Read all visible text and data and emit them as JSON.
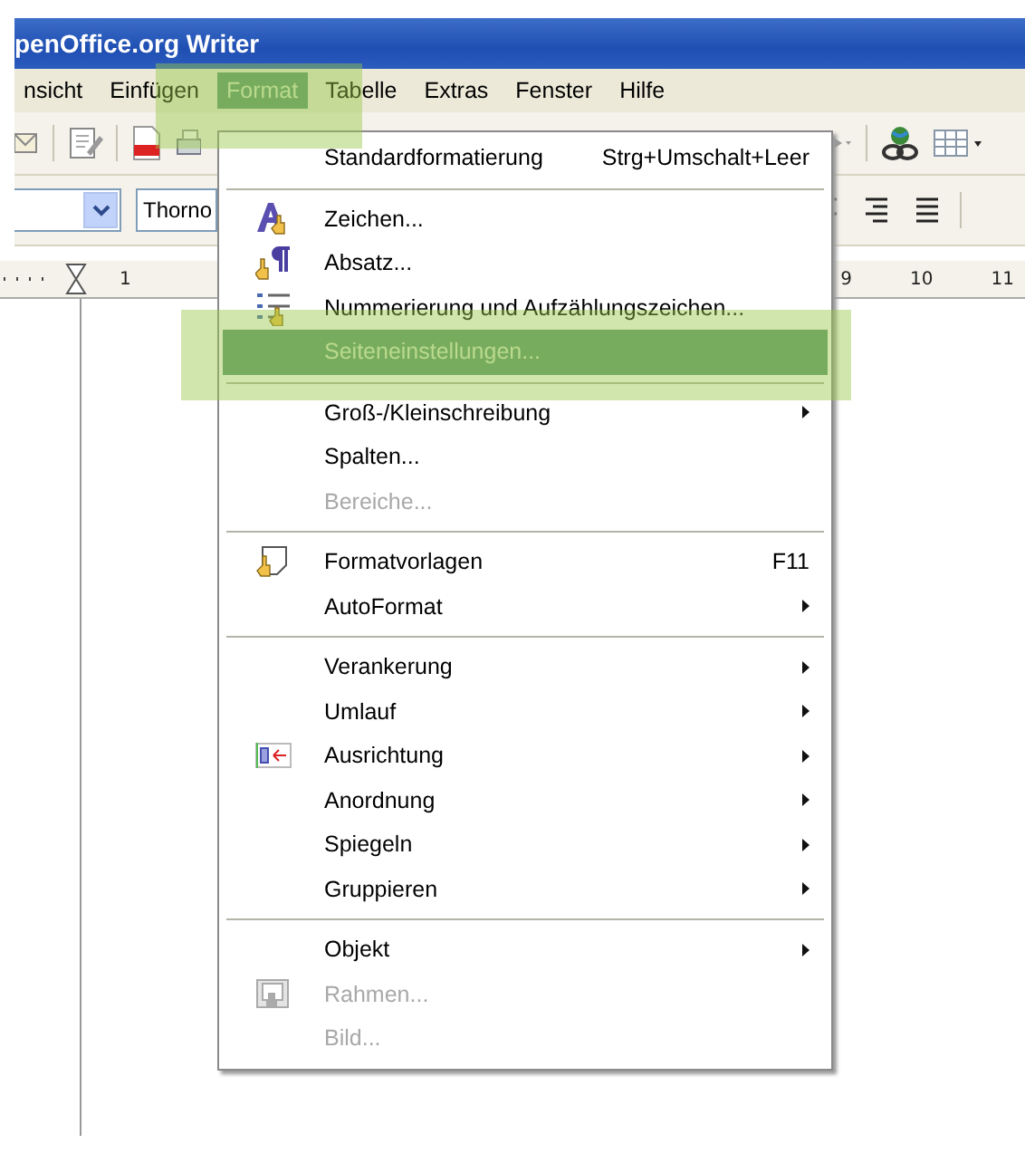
{
  "window": {
    "title": "penOffice.org Writer"
  },
  "menubar": [
    {
      "label": "nsicht",
      "selected": false
    },
    {
      "label": "Einfügen",
      "selected": false
    },
    {
      "label": "Format",
      "selected": true
    },
    {
      "label": "Tabelle",
      "selected": false
    },
    {
      "label": "Extras",
      "selected": false
    },
    {
      "label": "Fenster",
      "selected": false
    },
    {
      "label": "Hilfe",
      "selected": false
    }
  ],
  "formatbar": {
    "font": "Thorno"
  },
  "ruler": {
    "left_labels": [
      "1"
    ],
    "right_labels": [
      "9",
      "10",
      "11"
    ]
  },
  "menu": [
    {
      "kind": "item",
      "label": "Standardformatierung",
      "shortcut": "Strg+Umschalt+Leer",
      "submenu": false,
      "disabled": false,
      "selected": false
    },
    {
      "kind": "separator"
    },
    {
      "kind": "item",
      "label": "Zeichen...",
      "submenu": false,
      "disabled": false,
      "selected": false
    },
    {
      "kind": "item",
      "label": "Absatz...",
      "submenu": false,
      "disabled": false,
      "selected": false
    },
    {
      "kind": "item",
      "label": "Nummerierung und Aufzählungszeichen...",
      "submenu": false,
      "disabled": false,
      "selected": false
    },
    {
      "kind": "item",
      "label": "Seiteneinstellungen...",
      "submenu": false,
      "disabled": false,
      "selected": true
    },
    {
      "kind": "separator"
    },
    {
      "kind": "item",
      "label": "Groß-/Kleinschreibung",
      "submenu": true,
      "disabled": false,
      "selected": false
    },
    {
      "kind": "item",
      "label": "Spalten...",
      "submenu": false,
      "disabled": false,
      "selected": false
    },
    {
      "kind": "item",
      "label": "Bereiche...",
      "submenu": false,
      "disabled": true,
      "selected": false
    },
    {
      "kind": "separator"
    },
    {
      "kind": "item",
      "label": "Formatvorlagen",
      "shortcut": "F11",
      "submenu": false,
      "disabled": false,
      "selected": false
    },
    {
      "kind": "item",
      "label": "AutoFormat",
      "submenu": true,
      "disabled": false,
      "selected": false
    },
    {
      "kind": "separator"
    },
    {
      "kind": "item",
      "label": "Verankerung",
      "submenu": true,
      "disabled": false,
      "selected": false
    },
    {
      "kind": "item",
      "label": "Umlauf",
      "submenu": true,
      "disabled": false,
      "selected": false
    },
    {
      "kind": "item",
      "label": "Ausrichtung",
      "submenu": true,
      "disabled": false,
      "selected": false
    },
    {
      "kind": "item",
      "label": "Anordnung",
      "submenu": true,
      "disabled": false,
      "selected": false
    },
    {
      "kind": "item",
      "label": "Spiegeln",
      "submenu": true,
      "disabled": false,
      "selected": false
    },
    {
      "kind": "item",
      "label": "Gruppieren",
      "submenu": true,
      "disabled": false,
      "selected": false
    },
    {
      "kind": "separator"
    },
    {
      "kind": "item",
      "label": "Objekt",
      "submenu": true,
      "disabled": false,
      "selected": false
    },
    {
      "kind": "item",
      "label": "Rahmen...",
      "submenu": false,
      "disabled": true,
      "selected": false
    },
    {
      "kind": "item",
      "label": "Bild...",
      "submenu": false,
      "disabled": true,
      "selected": false
    }
  ]
}
